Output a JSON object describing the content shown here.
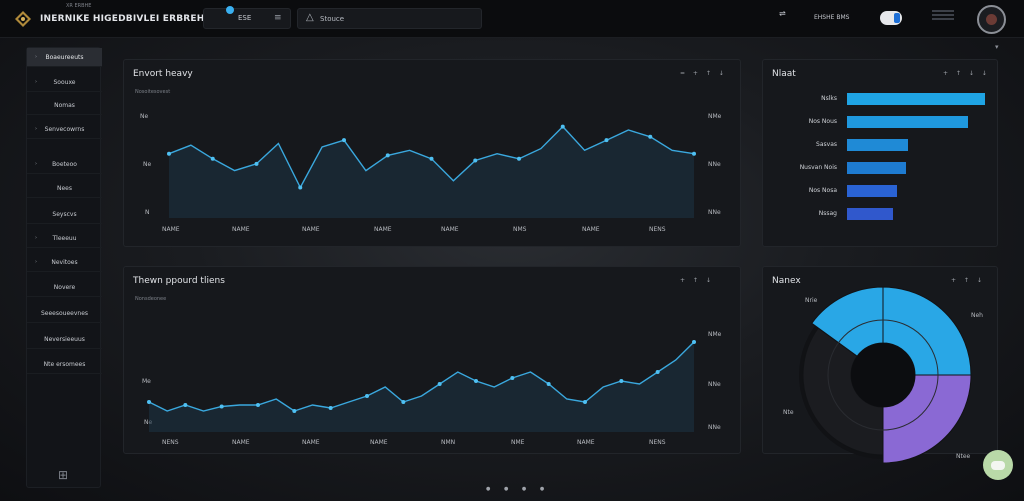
{
  "app": {
    "title": "INERNIKE HIGEDBIVLEI ERBREHLIYERBUT",
    "subtitle": "XR ERBHE"
  },
  "topbar": {
    "segment_label": "ESE",
    "segment_menu_icon": "menu-icon",
    "search_placeholder": "Stouce",
    "search_icon": "warning-triangle-icon",
    "right_icon": "filter-icon",
    "right_label": "EHSHE BMS",
    "toggle_on": true,
    "avatar_icon": "avatar-icon"
  },
  "sidebar": {
    "items": [
      {
        "label": "Boaeureeuts",
        "active": true,
        "caret": true
      },
      {
        "label": "Soouxe",
        "active": false,
        "caret": true
      },
      {
        "label": "Nomas",
        "active": false,
        "caret": false
      },
      {
        "label": "Senvecowrns",
        "active": false,
        "caret": true
      },
      {
        "label": "Boeteoo",
        "active": false,
        "caret": true
      },
      {
        "label": "Nees",
        "active": false,
        "caret": false
      },
      {
        "label": "Seyscvs",
        "active": false,
        "caret": false
      },
      {
        "label": "Tleeeuu",
        "active": false,
        "caret": true
      },
      {
        "label": "Nevitoes",
        "active": false,
        "caret": true
      },
      {
        "label": "Novere",
        "active": false,
        "caret": false
      },
      {
        "label": "Seeesoueevnes",
        "active": false,
        "caret": false
      },
      {
        "label": "Neversieeuus",
        "active": false,
        "caret": false
      },
      {
        "label": "Nte ersomees",
        "active": false,
        "caret": false
      }
    ],
    "grid_icon": "grid-icon"
  },
  "panels": {
    "top_left": {
      "title": "Envort heavy",
      "subtitle": "Nosoitesovest",
      "controls": "=   +   ↑   ↓",
      "y_ticks_left": [
        "Ne",
        "Ne",
        "N"
      ],
      "y_ticks_right": [
        "NMe",
        "NNe",
        "NNe"
      ],
      "x_ticks": [
        "NAME",
        "NAME",
        "NAME",
        "NAME",
        "NAME",
        "NMS",
        "NAME",
        "NENS"
      ]
    },
    "bottom_left": {
      "title": "Thewn ppourd tliens",
      "subtitle": "Nonsdeonee",
      "controls": "+   ↑   ↓",
      "y_ticks_left": [
        "Me",
        "Ne"
      ],
      "y_ticks_right": [
        "NMe",
        "NNe",
        "NNe"
      ],
      "x_ticks": [
        "NENS",
        "NAME",
        "NAME",
        "NAME",
        "NMN",
        "NME",
        "NAME",
        "NENS"
      ]
    },
    "top_right": {
      "title": "Nlaat",
      "controls": "+   ↑   ↓   ↓"
    },
    "bottom_right": {
      "title": "Nanex",
      "controls": "+   ↑   ↓",
      "labels": [
        "Nrie",
        "Neh",
        "Nte",
        "Ntee"
      ]
    }
  },
  "chart_data": [
    {
      "type": "area",
      "title": "Envort heavy",
      "x": [
        0,
        1,
        2,
        3,
        4,
        5,
        6,
        7,
        8,
        9,
        10,
        11,
        12,
        13,
        14,
        15,
        16,
        17,
        18,
        19,
        20,
        21,
        22,
        23,
        24
      ],
      "series": [
        {
          "values": [
            58,
            63,
            55,
            48,
            52,
            64,
            38,
            62,
            66,
            48,
            57,
            60,
            55,
            42,
            54,
            58,
            55,
            61,
            74,
            60,
            66,
            72,
            68,
            60,
            58
          ]
        }
      ]
    },
    {
      "type": "area",
      "title": "Thewn ppourd tliens",
      "x": [
        0,
        1,
        2,
        3,
        4,
        5,
        6,
        7,
        8,
        9,
        10,
        11,
        12,
        13,
        14,
        15,
        16,
        17,
        18,
        19,
        20,
        21,
        22,
        23,
        24,
        25,
        26,
        27,
        28,
        29,
        30
      ],
      "series": [
        {
          "values": [
            30,
            24,
            28,
            24,
            27,
            28,
            28,
            32,
            24,
            28,
            26,
            30,
            34,
            40,
            30,
            34,
            42,
            50,
            44,
            40,
            46,
            50,
            42,
            32,
            30,
            40,
            44,
            42,
            50,
            58,
            70
          ]
        }
      ]
    },
    {
      "type": "bar",
      "title": "Nlaat",
      "categories": [
        "Nslks",
        "Nos Nous",
        "Sasvas",
        "Nusvan Nois",
        "Nos Nosa",
        "Nssag"
      ],
      "values": [
        100,
        88,
        44,
        43,
        36,
        33
      ],
      "colors": [
        "#1fa4e4",
        "#1f98de",
        "#1f8ad6",
        "#1e7bd1",
        "#2a63d4",
        "#3058cc"
      ]
    },
    {
      "type": "pie",
      "title": "Nanex",
      "categories": [
        "segment-blue-top",
        "segment-purple",
        "segment-dark",
        "segment-blue-left"
      ],
      "values": [
        25,
        25,
        35,
        15
      ],
      "colors": [
        "#29a7e6",
        "#8a69d4",
        "#1b1c20",
        "#29a7e6"
      ]
    }
  ]
}
